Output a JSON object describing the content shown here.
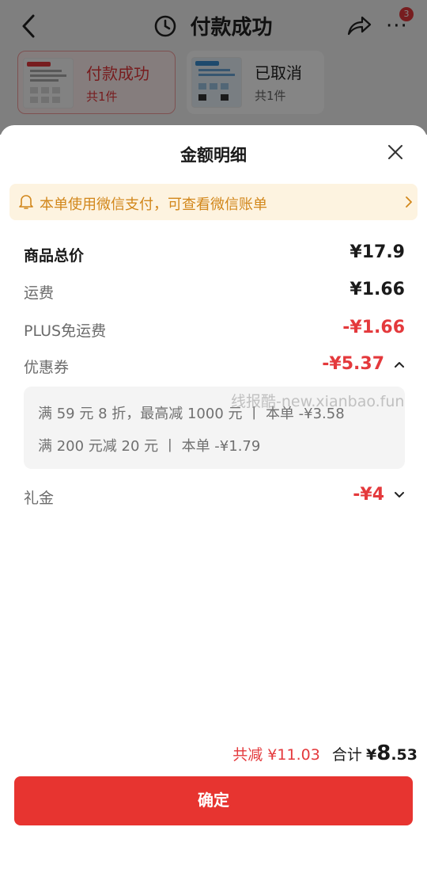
{
  "header": {
    "title": "付款成功",
    "badge_count": "3"
  },
  "orders": [
    {
      "name": "付款成功",
      "count": "共1件"
    },
    {
      "name": "已取消",
      "count": "共1件"
    }
  ],
  "sheet": {
    "title": "金额明细",
    "notice": "本单使用微信支付，可查看微信账单",
    "rows": {
      "goods_total": {
        "label": "商品总价",
        "value": "¥17.9"
      },
      "shipping": {
        "label": "运费",
        "value": "¥1.66"
      },
      "plus_free_shipping": {
        "label": "PLUS免运费",
        "value": "-¥1.66"
      },
      "coupon": {
        "label": "优惠券",
        "value": "-¥5.37"
      },
      "gift_money": {
        "label": "礼金",
        "value": "-¥4"
      }
    },
    "coupon_details": [
      "满 59 元 8 折，最高减 1000 元  丨  本单 -¥3.58",
      "满 200 元减 20 元  丨  本单 -¥1.79"
    ],
    "watermark": "线报酷-new.xianbao.fun",
    "summary": {
      "discount": "共减 ¥11.03",
      "total_label": "合计",
      "currency": "¥",
      "total_int": "8",
      "total_dec": ".53"
    },
    "confirm_label": "确定"
  },
  "colors": {
    "accent": "#e4393c",
    "notice_bg": "#fdf3e0",
    "notice_text": "#d2871b"
  }
}
